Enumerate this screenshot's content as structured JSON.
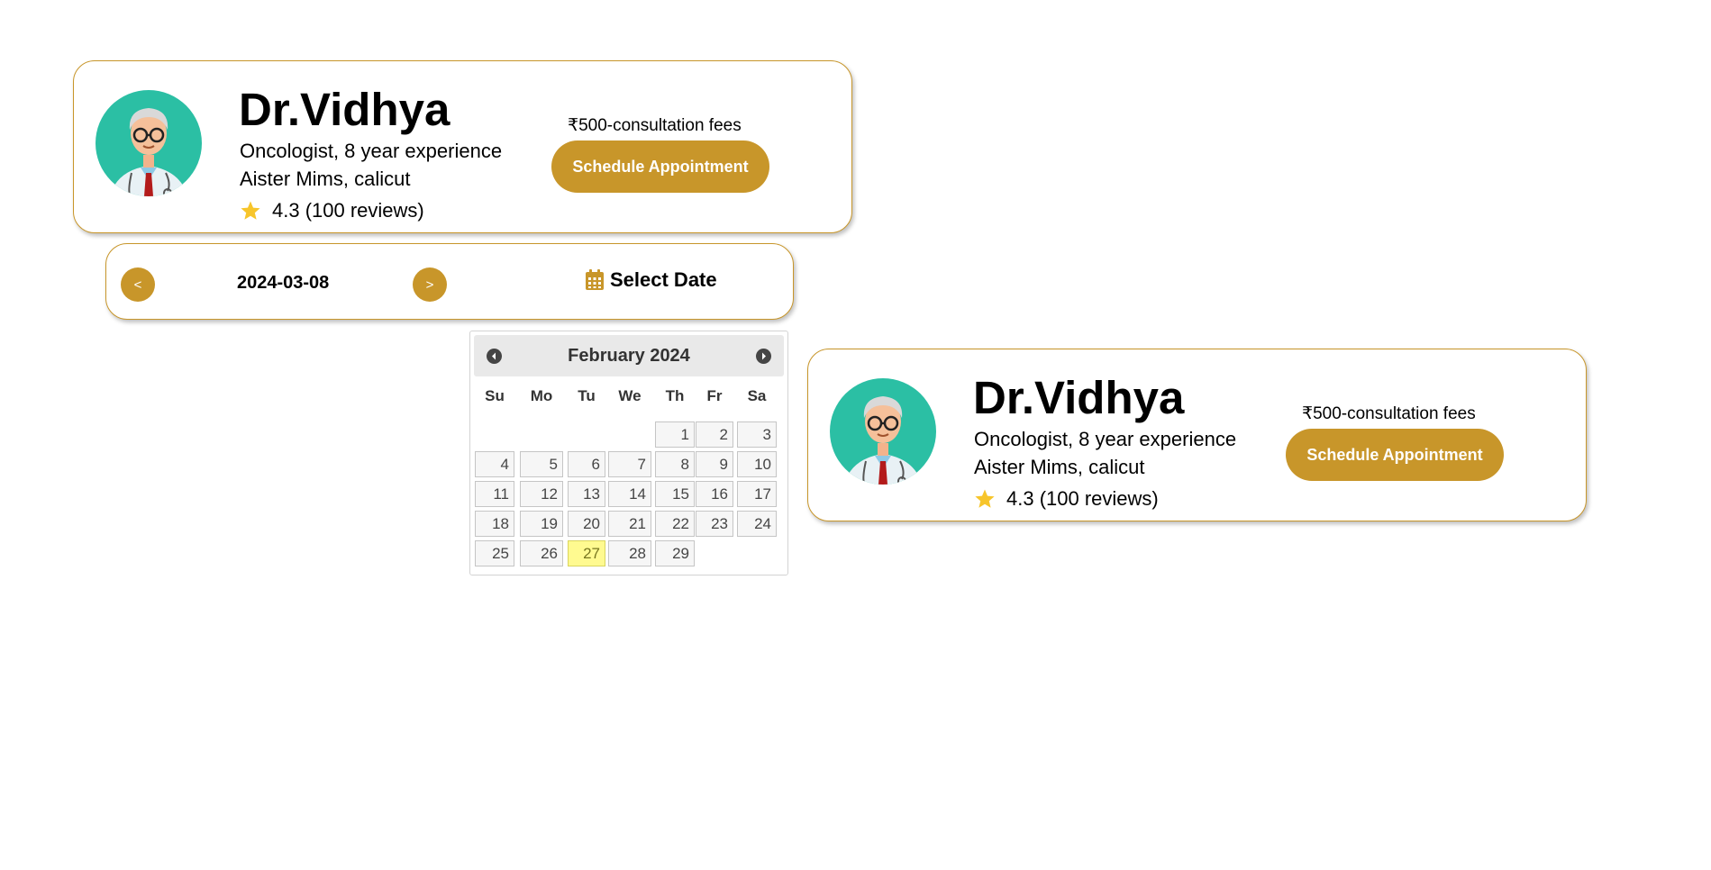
{
  "doctor_card_1": {
    "name": "Dr.Vidhya",
    "specialty": "Oncologist, 8 year experience",
    "hospital": "Aister Mims, calicut",
    "rating": "4.3 (100 reviews)",
    "fees": "₹500-consultation fees",
    "button_label": "Schedule Appointment"
  },
  "date_bar": {
    "prev_label": "<",
    "date": "2024-03-08",
    "next_label": ">",
    "select_label": "Select Date",
    "select_icon": "calendar-icon"
  },
  "calendar": {
    "month_label": "February 2024",
    "weekdays": [
      "Su",
      "Mo",
      "Tu",
      "We",
      "Th",
      "Fr",
      "Sa"
    ],
    "first_weekday_index": 4,
    "days_in_month": 29,
    "highlighted_day": 27
  },
  "doctor_card_2": {
    "name": "Dr.Vidhya",
    "specialty": "Oncologist, 8 year experience",
    "hospital": "Aister Mims, calicut",
    "rating": "4.3 (100 reviews)",
    "fees": "₹500-consultation fees",
    "button_label": "Schedule Appointment"
  },
  "colors": {
    "accent": "#c8962a",
    "avatar_bg": "#2bbfa4",
    "star": "#f7c52b",
    "today_bg": "#fffa90"
  }
}
